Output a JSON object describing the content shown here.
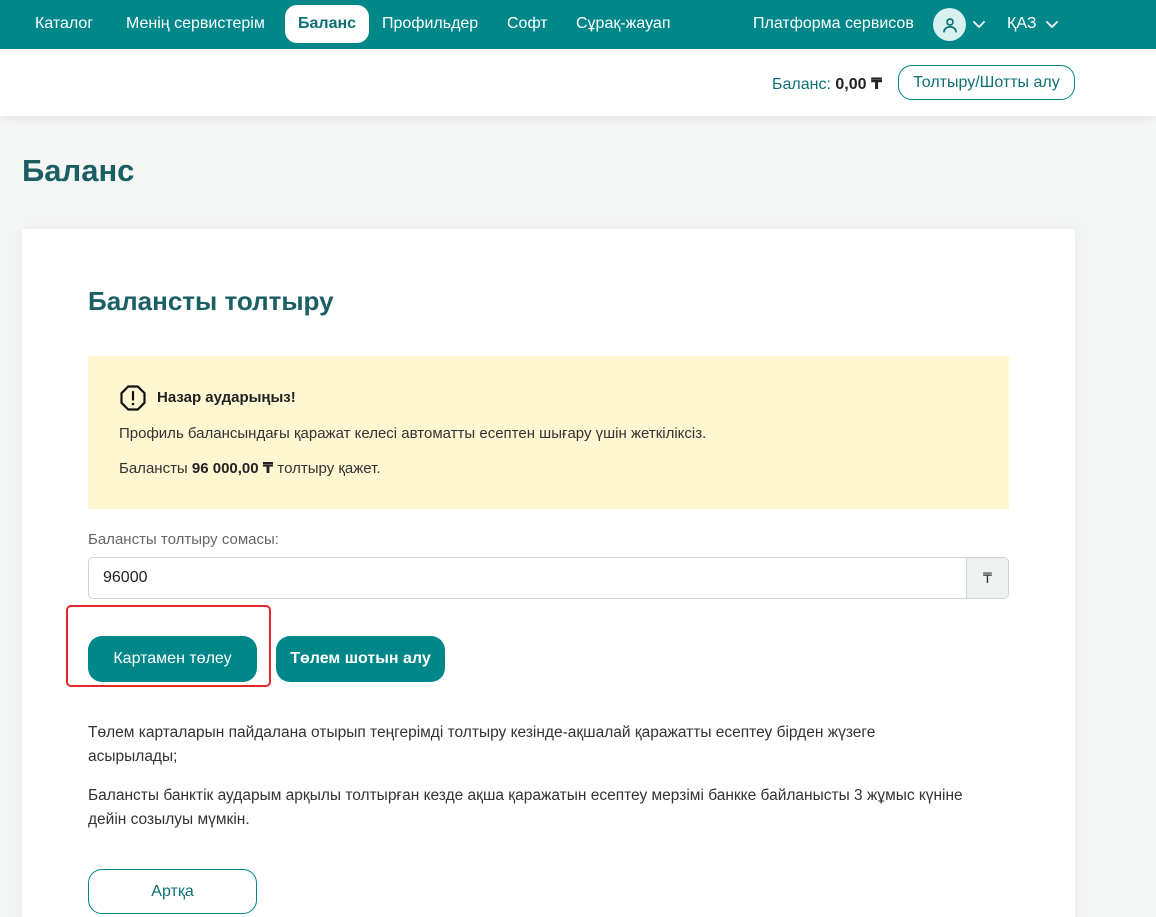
{
  "nav": {
    "catalog": "Каталог",
    "my_services": "Менің сервистерім",
    "balance": "Баланс",
    "profiles": "Профильдер",
    "soft": "Софт",
    "faq": "Сұрақ-жауап",
    "platform": "Платформа сервисов",
    "language": "ҚАЗ"
  },
  "subheader": {
    "balance_label": "Баланс:",
    "balance_value": "0,00 ₸",
    "topup_button": "Толтыру/Шотты алу"
  },
  "page": {
    "title": "Баланс"
  },
  "card": {
    "title": "Балансты толтыру",
    "warning": {
      "title": "Назар аударыңыз!",
      "text1": "Профиль балансындағы қаражат келесі автоматты есептен шығару үшін жеткіліксіз.",
      "text2_prefix": "Балансты ",
      "text2_amount": "96 000,00 ₸",
      "text2_suffix": " толтыру қажет."
    },
    "amount_label": "Балансты толтыру сомасы:",
    "amount_value": "96000",
    "currency_symbol": "₸",
    "pay_card_button": "Картамен төлеу",
    "invoice_button": "Төлем шотын алу",
    "info1": "Төлем карталарын пайдалана отырып теңгерімді толтыру кезінде-ақшалай қаражатты есептеу бірден жүзеге асырылады;",
    "info2": "Балансты банктік аударым арқылы толтырған кезде ақша қаражатын есептеу мерзімі банкке байланысты 3 жұмыс күніне дейін созылуы мүмкін.",
    "back_button": "Артқа"
  },
  "icons": {
    "user": "user-icon",
    "chevron": "chevron-down-icon",
    "warning": "warning-octagon-icon"
  },
  "colors": {
    "brand": "#00878a",
    "title": "#1a5f63",
    "warning_bg": "#fff6d2",
    "highlight": "#e5262b"
  }
}
